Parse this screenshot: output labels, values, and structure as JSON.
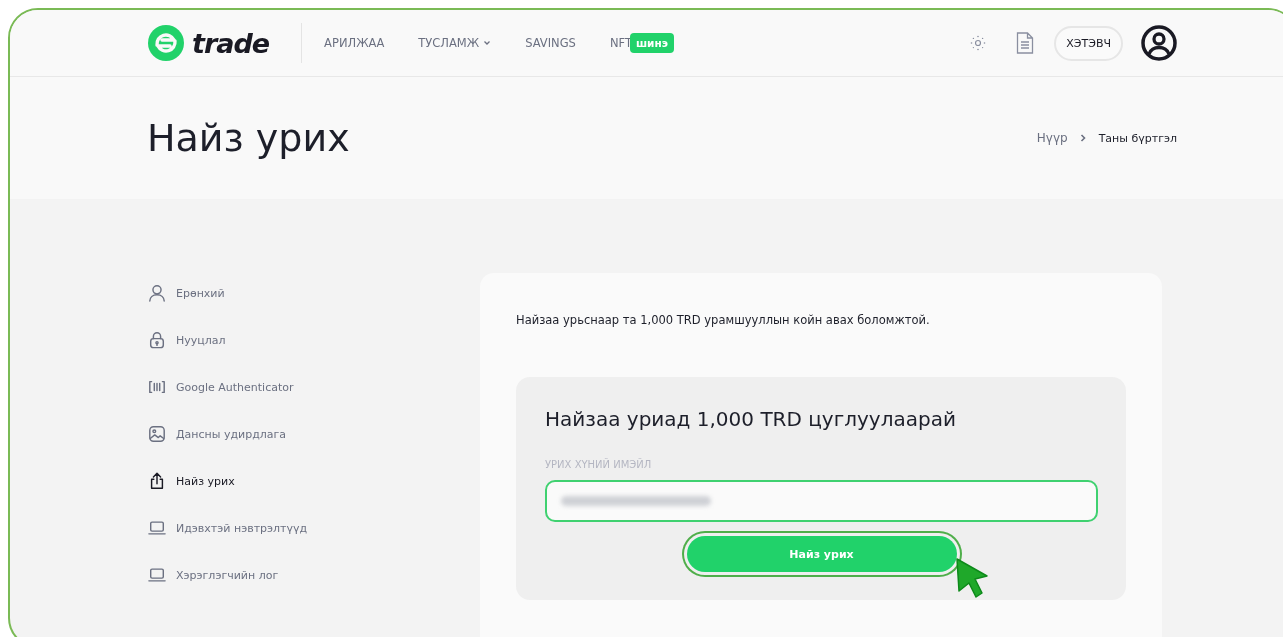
{
  "header": {
    "logo_text": "trade",
    "nav": [
      {
        "label": "АРИЛЖАА",
        "dropdown": false
      },
      {
        "label": "ТУСЛАМЖ",
        "dropdown": true
      },
      {
        "label": "SAVINGS",
        "dropdown": false
      },
      {
        "label": "NFT",
        "dropdown": false,
        "badge": "шинэ"
      }
    ],
    "wallet_button": "ХЭТЭВЧ"
  },
  "page_title": "Найз урих",
  "breadcrumb": [
    "Нүүр",
    "Таны бүртгэл"
  ],
  "sidebar": {
    "items": [
      {
        "label": "Ерөнхий",
        "kind": "user",
        "selected": false
      },
      {
        "label": "Нууцлал",
        "kind": "lock",
        "selected": false
      },
      {
        "label": "Google Authenticator",
        "kind": "scan",
        "selected": false
      },
      {
        "label": "Дансны удирдлага",
        "kind": "image",
        "selected": false
      },
      {
        "label": "Найз урих",
        "kind": "share",
        "selected": true
      },
      {
        "label": "Идэвхтэй нэвтрэлтүүд",
        "kind": "laptop",
        "selected": false
      },
      {
        "label": "Хэрэглэгчийн лог",
        "kind": "laptop",
        "selected": false
      }
    ]
  },
  "intro": "Найзаа урьснаар та 1,000 TRD урамшууллын койн авах боломжтой.",
  "invite_box": {
    "title": "Найзаа уриад 1,000 TRD цуглуулаарай",
    "email_label": "УРИХ ХҮНИЙ ИМЭЙЛ",
    "email_blurred": true,
    "submit": "Найз урих"
  }
}
